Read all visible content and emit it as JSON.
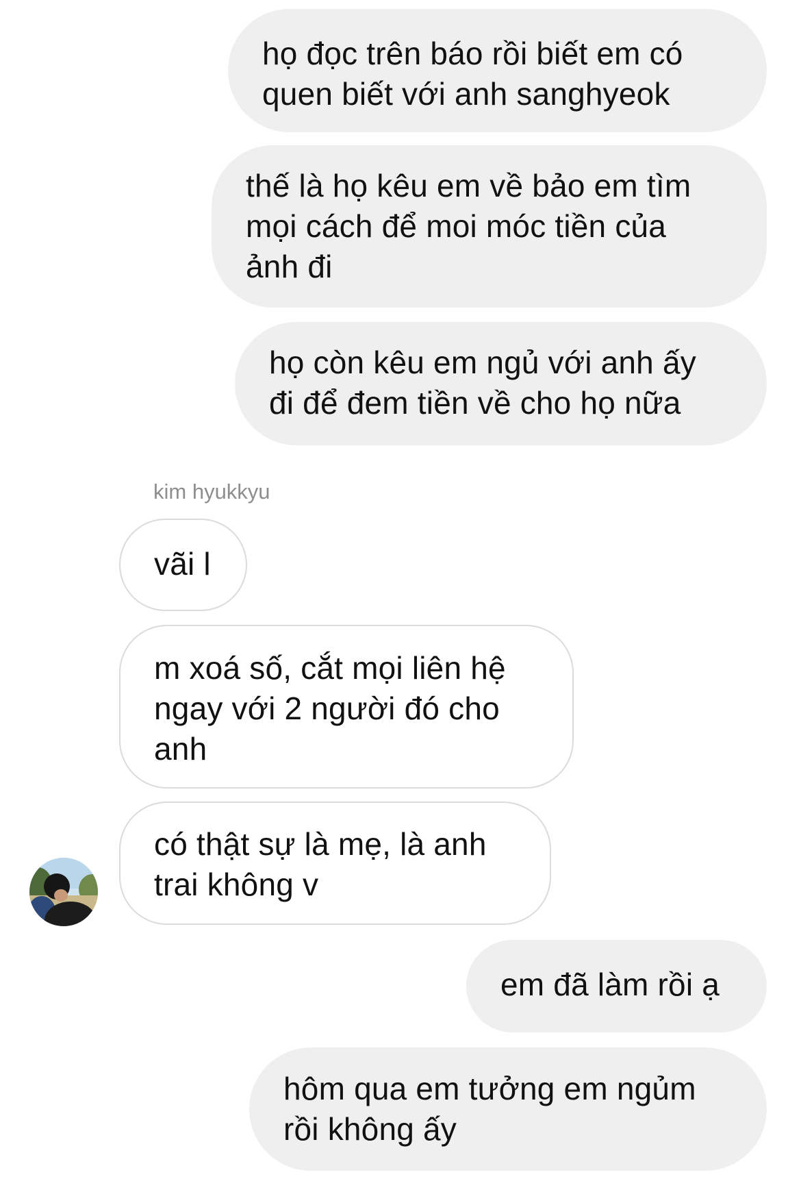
{
  "conversation": {
    "sender_name": "kim hyukkyu",
    "messages": [
      {
        "from": "me",
        "lines": [
          "họ đọc trên báo rồi biết em có",
          "quen biết với anh sanghyeok"
        ]
      },
      {
        "from": "me",
        "lines": [
          "thế là họ kêu em về bảo em tìm",
          "mọi cách để moi móc tiền của",
          "ảnh đi"
        ]
      },
      {
        "from": "me",
        "lines": [
          "họ còn kêu em ngủ với anh ấy",
          "đi để đem tiền về cho họ nữa"
        ]
      },
      {
        "from": "them",
        "lines": [
          "vãi l"
        ]
      },
      {
        "from": "them",
        "lines": [
          "m xoá số, cắt mọi liên hệ",
          "ngay với 2 người đó cho",
          "anh"
        ]
      },
      {
        "from": "them",
        "lines": [
          "có thật sự là mẹ, là anh",
          "trai không v"
        ]
      },
      {
        "from": "me",
        "lines": [
          "em đã làm rồi ạ"
        ]
      },
      {
        "from": "me",
        "lines": [
          "hôm qua em tưởng em ngủm",
          "rồi không ấy"
        ]
      }
    ]
  },
  "colors": {
    "outgoing_bubble": "#efefef",
    "incoming_border": "#dbdbdb",
    "sender_label": "#8e8e8e"
  }
}
